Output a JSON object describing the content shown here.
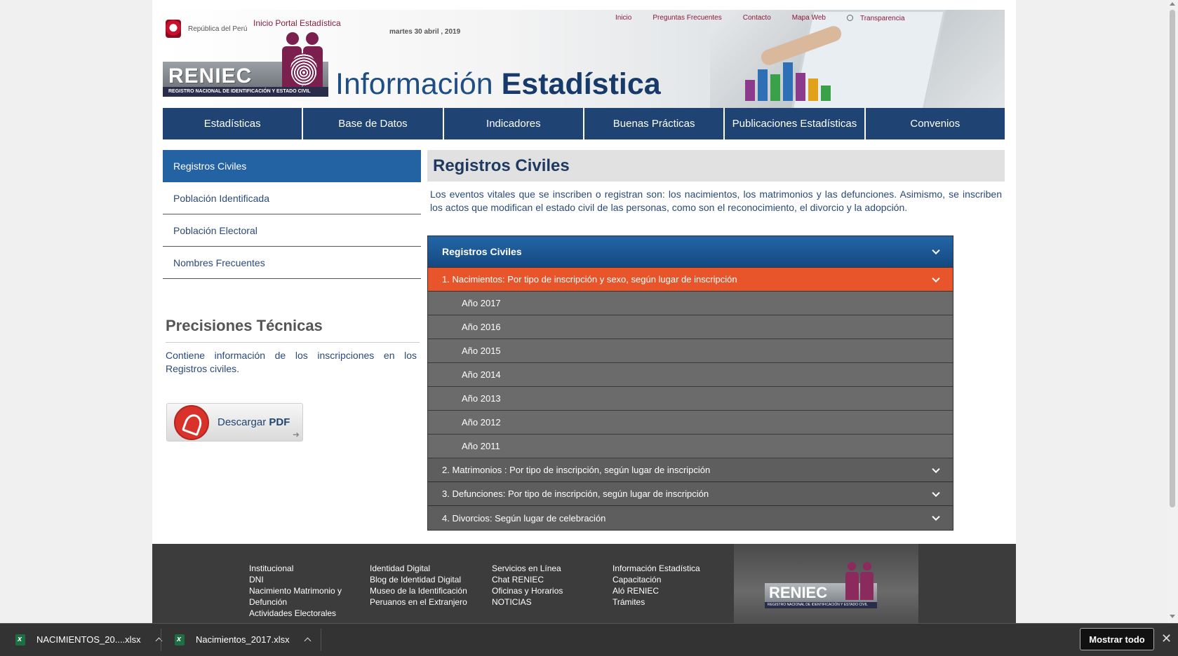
{
  "header": {
    "country_label": "República del Perú",
    "portal_link": "Inicio Portal Estadística",
    "date": "martes 30 abril , 2019",
    "top_links": [
      "Inicio",
      "Preguntas Frecuentes",
      "Contacto",
      "Mapa Web",
      "Transparencia"
    ],
    "logo_word": "RENIEC",
    "logo_subtitle": "REGISTRO NACIONAL DE IDENTIFICACIÓN Y ESTADO CIVIL",
    "title_light": "Información",
    "title_bold": "Estadística"
  },
  "nav": [
    "Estadísticas",
    "Base de Datos",
    "Indicadores",
    "Buenas Prácticas",
    "Publicaciones Estadísticas",
    "Convenios"
  ],
  "sidebar": {
    "items": [
      "Registros Civiles",
      "Población Identificada",
      "Población Electoral",
      "Nombres Frecuentes"
    ],
    "precisiones_title": "Precisiones Técnicas",
    "precisiones_text": "Contiene información de los inscripciones en los Registros civiles.",
    "pdf_button_prefix": "Descargar",
    "pdf_button_bold": "PDF"
  },
  "main": {
    "title": "Registros Civiles",
    "description": "Los eventos vitales que se inscriben o registran son: los nacimientos, los matrimonios y las defunciones. Asimismo, se inscriben los actos que modifican el estado civil de las personas, como son el reconocimiento, el divorcio y la adopción.",
    "accordion": {
      "header": "Registros Civiles",
      "open_section": "1. Nacimientos: Por tipo de inscripción y sexo, según lugar de inscripción",
      "years": [
        "Año 2017",
        "Año 2016",
        "Año 2015",
        "Año 2014",
        "Año 2013",
        "Año 2012",
        "Año 2011"
      ],
      "other_sections": [
        "2. Matrimonios : Por tipo de inscripción, según lugar de inscripción",
        "3. Defunciones: Por tipo de inscripción, según lugar de inscripción",
        "4. Divorcios: Según lugar de celebración"
      ]
    }
  },
  "footer": {
    "columns": [
      [
        "Institucional",
        "DNI",
        "Nacimiento Matrimonio y",
        "Defunción",
        "Actividades Electorales"
      ],
      [
        "Identidad Digital",
        "Blog de Identidad Digital",
        "Museo de la Identificación",
        "Peruanos en el Extranjero"
      ],
      [
        "Servicios en Línea",
        "Chat RENIEC",
        "Oficinas y Horarios",
        "NOTICIAS"
      ],
      [
        "Información Estadística",
        "Capacitación",
        "Aló RENIEC",
        "Trámites"
      ]
    ],
    "logo_word": "RENIEC",
    "logo_subtitle": "REGISTRO NACIONAL DE IDENTIFICACIÓN Y ESTADO CIVIL"
  },
  "downloads": {
    "items": [
      "NACIMIENTOS_20....xlsx",
      "Nacimientos_2017.xlsx"
    ],
    "show_all": "Mostrar todo",
    "close": "✕"
  }
}
